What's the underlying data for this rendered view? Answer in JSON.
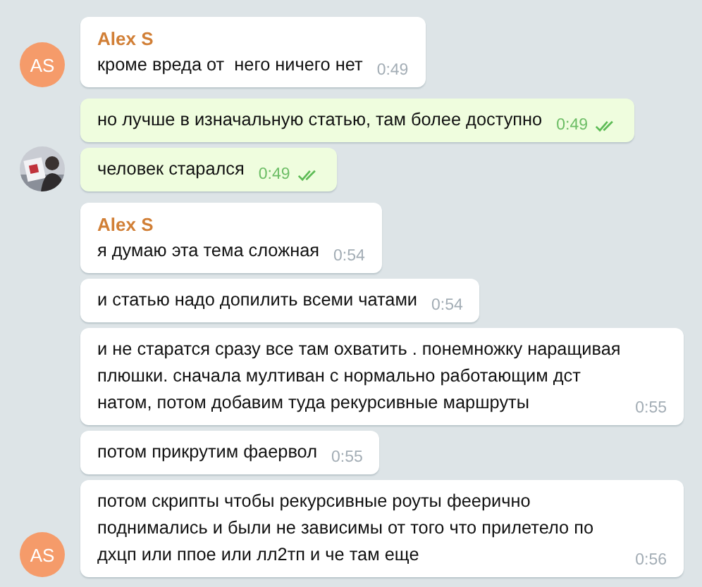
{
  "groups": [
    {
      "avatar": {
        "kind": "initials",
        "initials": "AS"
      },
      "sender": "Alex S",
      "outgoing": false,
      "messages": [
        {
          "text": "кроме вреда от  него ничего нет",
          "time": "0:49"
        }
      ]
    },
    {
      "avatar": {
        "kind": "picture"
      },
      "outgoing": true,
      "messages": [
        {
          "text": "но лучше в изначальную статью, там более доступно",
          "time": "0:49",
          "read": true
        },
        {
          "text": "человек старался",
          "time": "0:49",
          "read": true
        }
      ]
    },
    {
      "avatar": {
        "kind": "initials",
        "initials": "AS"
      },
      "sender": "Alex S",
      "outgoing": false,
      "messages": [
        {
          "text": "я думаю эта тема сложная",
          "time": "0:54"
        },
        {
          "text": "и статью надо допилить всеми чатами",
          "time": "0:54"
        },
        {
          "text": "и не старатся сразу все там охватить . понемножку наращивая плюшки. сначала мултиван с нормально работающим дст натом, потом добавим туда рекурсивные маршруты",
          "time": "0:55"
        },
        {
          "text": "потом прикрутим фаервол",
          "time": "0:55"
        },
        {
          "text": "потом скрипты чтобы рекурсивные роуты феерично поднимались и были не зависимы от того что прилетело по дхцп или ппое или лл2тп и че там еще",
          "time": "0:56"
        }
      ]
    }
  ]
}
